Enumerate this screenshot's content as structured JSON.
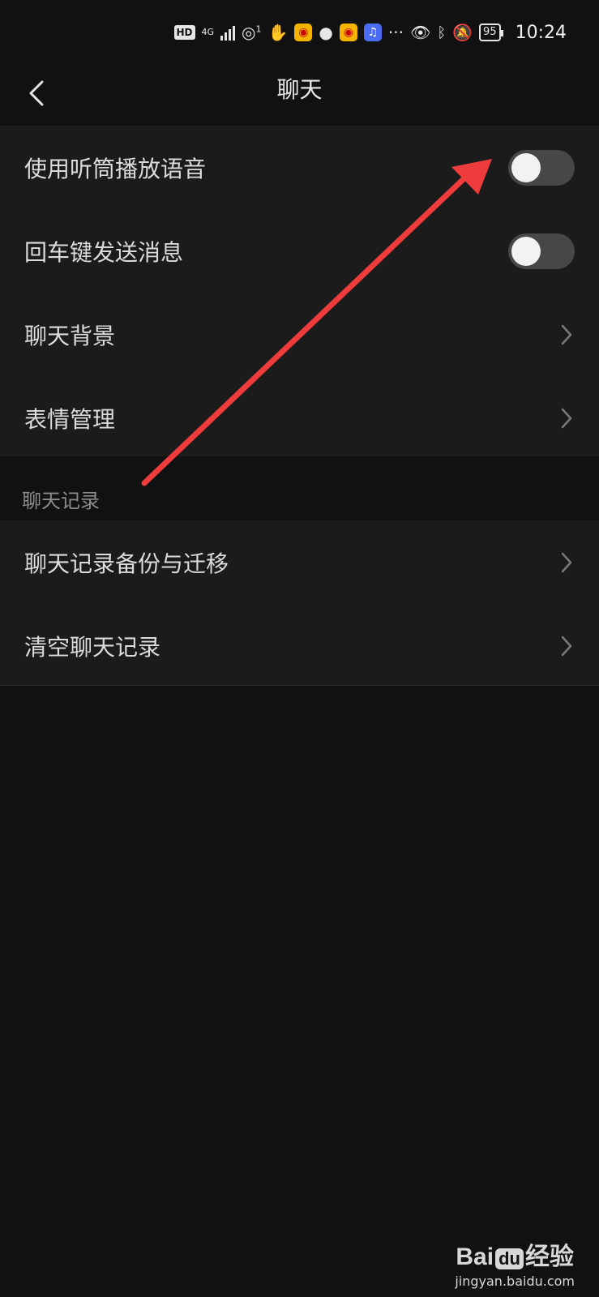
{
  "status_bar": {
    "hd": "HD",
    "network": "4G",
    "hotspot_count": "1",
    "more": "···",
    "battery": "95",
    "time": "10:24"
  },
  "nav": {
    "title": "聊天"
  },
  "settings": {
    "toggle_rows": [
      {
        "label": "使用听筒播放语音",
        "enabled": false
      },
      {
        "label": "回车键发送消息",
        "enabled": false
      }
    ],
    "link_rows": [
      {
        "label": "聊天背景"
      },
      {
        "label": "表情管理"
      }
    ]
  },
  "chat_history": {
    "header": "聊天记录",
    "rows": [
      {
        "label": "聊天记录备份与迁移"
      },
      {
        "label": "清空聊天记录"
      }
    ]
  },
  "watermark": {
    "logo": "Bai度经验",
    "logo_prefix": "Bai",
    "logo_paw": "du",
    "logo_suffix": "经验",
    "url": "jingyan.baidu.com"
  },
  "colors": {
    "background": "#111111",
    "row_bg": "#1b1b1b",
    "toggle_off": "#474747",
    "annotation_arrow": "#ee3b3b"
  }
}
